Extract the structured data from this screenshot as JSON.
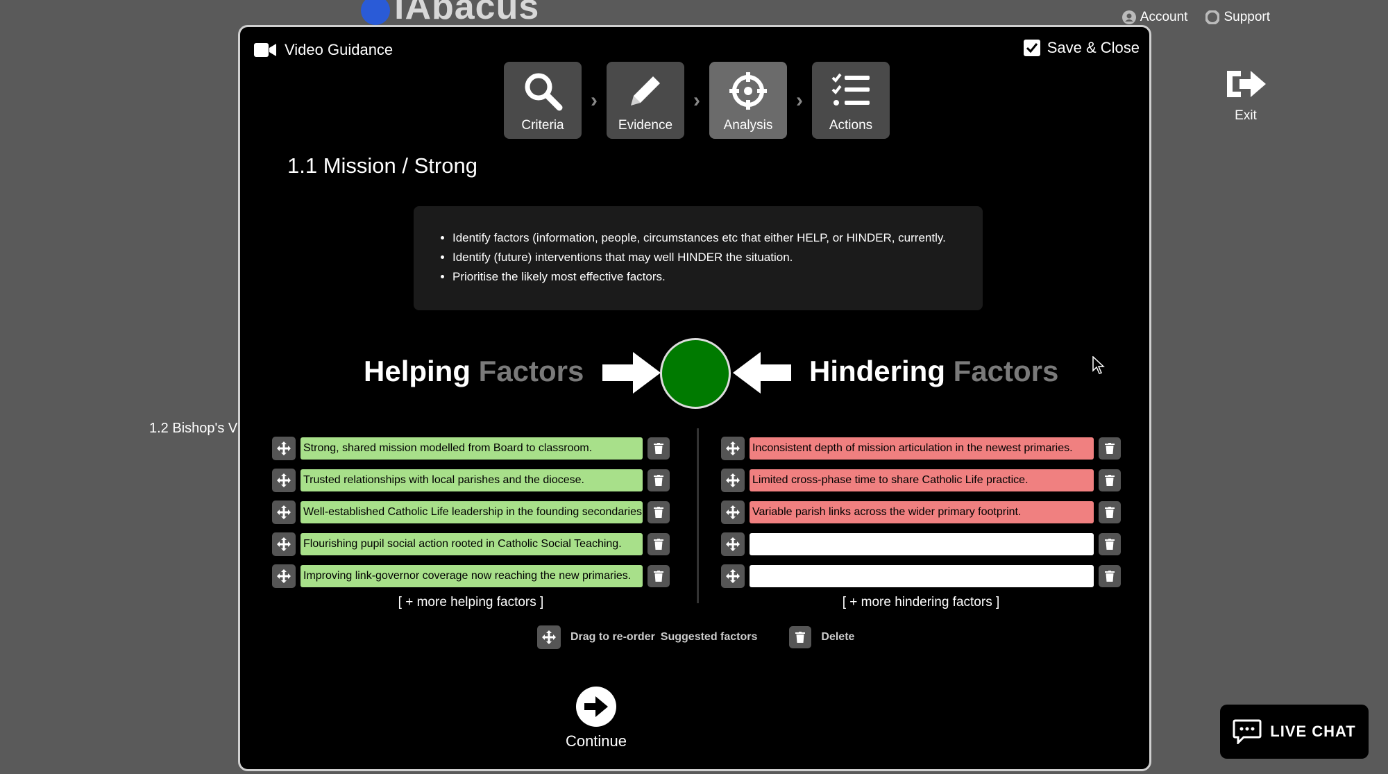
{
  "background": {
    "logo_text": "iAbacus",
    "nav": {
      "account": "Account",
      "support": "Support"
    },
    "exit_label": "Exit",
    "side_item": "1.2 Bishop's V"
  },
  "live_chat": "LIVE CHAT",
  "modal": {
    "video_guidance": "Video Guidance",
    "save_close": "Save & Close",
    "steps": [
      {
        "label": "Criteria",
        "icon": "search-icon"
      },
      {
        "label": "Evidence",
        "icon": "pencil-icon"
      },
      {
        "label": "Analysis",
        "icon": "crosshair-icon",
        "active": true
      },
      {
        "label": "Actions",
        "icon": "checklist-icon"
      }
    ],
    "section_title": "1.1 Mission / Strong",
    "instructions": [
      "Identify factors (information, people, circumstances etc that either HELP, or HINDER, currently.",
      "Identify (future) interventions that may well HINDER the situation.",
      "Prioritise the likely most effective factors."
    ],
    "helping": {
      "strong": "Helping",
      "dim": "Factors"
    },
    "hindering": {
      "strong": "Hindering",
      "dim": "Factors"
    },
    "center_color": "#007a00",
    "helping_factors": [
      "Strong, shared mission modelled from Board to classroom.",
      "Trusted relationships with local parishes and the diocese.",
      "Well-established Catholic Life leadership in the founding secondaries",
      "Flourishing pupil social action rooted in Catholic Social Teaching.",
      "Improving link-governor coverage now reaching the new primaries."
    ],
    "hindering_factors": [
      "Inconsistent depth of mission articulation in the newest primaries.",
      "Limited cross-phase time to share Catholic Life practice.",
      "Variable parish links across the wider primary footprint.",
      "",
      ""
    ],
    "more_helping": "[ + more helping factors ]",
    "more_hindering": "[ + more hindering factors ]",
    "legend": {
      "drag": "Drag to re-order",
      "suggested": "Suggested factors",
      "delete": "Delete"
    },
    "continue": "Continue"
  },
  "colors": {
    "helping": "#a8e08a",
    "hindering": "#f08080",
    "active_step": "#6b6b6b"
  }
}
